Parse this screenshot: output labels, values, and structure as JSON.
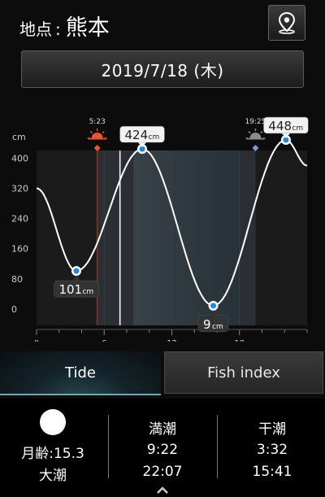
{
  "header": {
    "location_label": "地点",
    "location_separator": ":",
    "location_name": "熊本"
  },
  "date_button": {
    "label": "2019/7/18 (木)"
  },
  "chart_data": {
    "type": "line",
    "ylabel": "cm",
    "yticks": [
      "400",
      "320",
      "240",
      "160",
      "80",
      "0"
    ],
    "xticks": [
      "0",
      "6",
      "12",
      "18"
    ],
    "xlim": [
      0,
      24
    ],
    "ylim": [
      0,
      420
    ],
    "sunrise": "5:23",
    "sunset": "19:25",
    "series": [
      {
        "values": [
          [
            0,
            320
          ],
          [
            3.53,
            101
          ],
          [
            9.37,
            424
          ],
          [
            15.68,
            9
          ],
          [
            22.12,
            448
          ],
          [
            24,
            380
          ]
        ]
      }
    ],
    "extrema_labels": [
      {
        "x": 3.53,
        "y": 101,
        "value": "101",
        "unit": "cm"
      },
      {
        "x": 9.37,
        "y": 424,
        "value": "424",
        "unit": "cm"
      },
      {
        "x": 15.68,
        "y": 9,
        "value": "9",
        "unit": "cm"
      },
      {
        "x": 22.12,
        "y": 448,
        "value": "448",
        "unit": "cm"
      }
    ],
    "colors": {
      "line": "#ffffff",
      "marker": "#1e88e5",
      "sun": "#e8552a",
      "moon": "#7a9bd0"
    }
  },
  "tabs": [
    {
      "label": "Tide",
      "active": true
    },
    {
      "label": "Fish index",
      "active": false
    }
  ],
  "moon": {
    "age_label": "月齢",
    "age_separator": ":",
    "age_value": "15.3",
    "tide_type": "大潮"
  },
  "high_tide": {
    "label": "満潮",
    "times": [
      "9:22",
      "22:07"
    ]
  },
  "low_tide": {
    "label": "干潮",
    "times": [
      "3:32",
      "15:41"
    ]
  },
  "icons": {
    "location": "map-pin-icon",
    "sunrise": "sunrise-icon",
    "sunset": "sunset-icon",
    "expand": "chevron-up-icon"
  }
}
